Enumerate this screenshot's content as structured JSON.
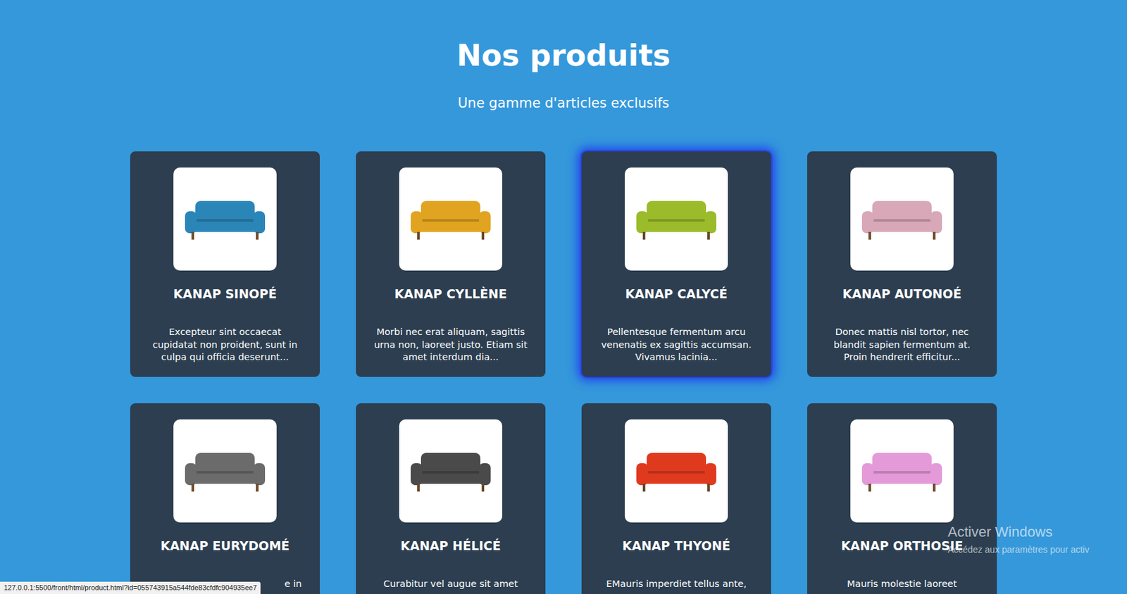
{
  "page": {
    "title": "Nos produits",
    "subtitle": "Une gamme d'articles exclusifs"
  },
  "products": [
    {
      "name": "KANAP SINOPÉ",
      "description": "Excepteur sint occaecat cupidatat non proident, sunt in culpa qui officia deserunt...",
      "color": "#2b86b8",
      "hovered": false
    },
    {
      "name": "KANAP CYLLÈNE",
      "description": "Morbi nec erat aliquam, sagittis urna non, laoreet justo. Etiam sit amet interdum dia...",
      "color": "#e0a420",
      "hovered": false
    },
    {
      "name": "KANAP CALYCÉ",
      "description": "Pellentesque fermentum arcu venenatis ex sagittis accumsan. Vivamus lacinia...",
      "color": "#9bbb2a",
      "hovered": true
    },
    {
      "name": "KANAP AUTONOÉ",
      "description": "Donec mattis nisl tortor, nec blandit sapien fermentum at. Proin hendrerit efficitur...",
      "color": "#d8a8b8",
      "hovered": false
    },
    {
      "name": "KANAP EURYDOMÉ",
      "description": "e in",
      "color": "#6b6b6b",
      "hovered": false
    },
    {
      "name": "KANAP HÉLICÉ",
      "description": "Curabitur vel augue sit amet",
      "color": "#4a4a4a",
      "hovered": false
    },
    {
      "name": "KANAP THYONÉ",
      "description": "EMauris imperdiet tellus ante,",
      "color": "#e03a1e",
      "hovered": false
    },
    {
      "name": "KANAP ORTHOSIE",
      "description": "Mauris molestie laoreet",
      "color": "#e49ad8",
      "hovered": false
    }
  ],
  "status_bar": {
    "url": "127.0.0.1:5500/front/html/product.html?id=055743915a544fde83cfdfc904935ee7"
  },
  "watermark": {
    "title": "Activer Windows",
    "subtitle": "Accédez aux paramètres pour activ"
  }
}
